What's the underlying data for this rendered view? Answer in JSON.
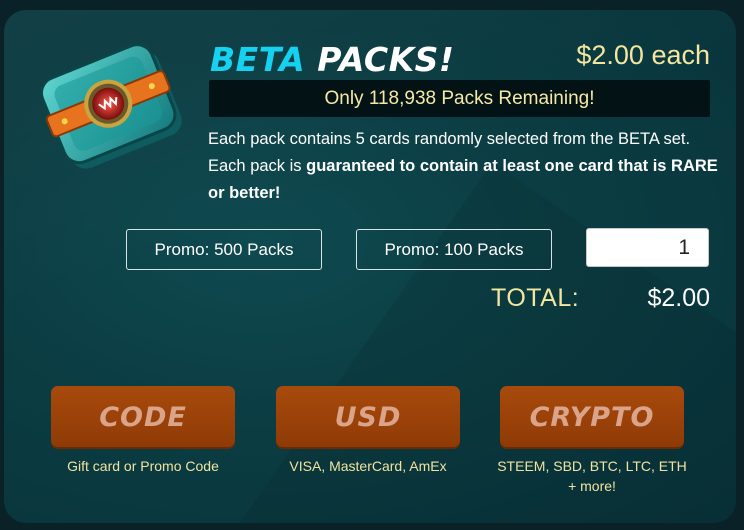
{
  "header": {
    "title_part1": "BETA",
    "title_part2": "PACKS!",
    "price": "$2.00 each"
  },
  "remaining_banner": "Only 118,938 Packs Remaining!",
  "description": {
    "part1": "Each pack contains 5 cards randomly selected from the BETA set. Each pack is ",
    "bold": "guaranteed to contain at least one card that is RARE or better!"
  },
  "promo_buttons": {
    "promo_500": "Promo: 500 Packs",
    "promo_100": "Promo: 100 Packs"
  },
  "quantity": {
    "value": "1"
  },
  "total": {
    "label": "TOTAL:",
    "value": "$2.00"
  },
  "payment": {
    "code": {
      "label": "CODE",
      "subtitle": "Gift card or Promo Code"
    },
    "usd": {
      "label": "USD",
      "subtitle": "VISA, MasterCard, AmEx"
    },
    "crypto": {
      "label": "CRYPTO",
      "subtitle_line1": "STEEM, SBD, BTC, LTC, ETH",
      "subtitle_line2": "+ more!"
    }
  },
  "colors": {
    "accent_cyan": "#15d3f0",
    "accent_gold": "#f2e6a0",
    "button_orange": "#a84a0c",
    "panel_bg": "#0b3d43"
  },
  "icons": {
    "pack_image": "card-pack-icon"
  }
}
